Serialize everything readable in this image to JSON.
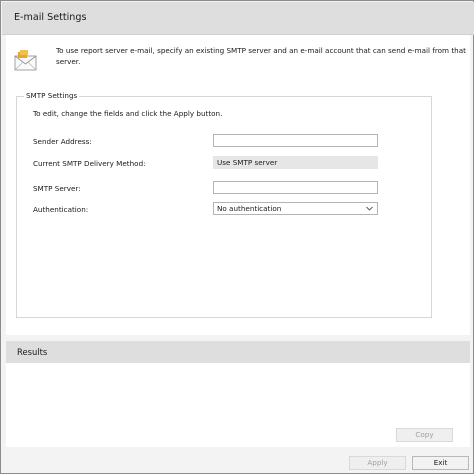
{
  "header": {
    "title": "E-mail Settings"
  },
  "intro": {
    "icon": "email-icon",
    "text": "To use report server e-mail, specify an existing SMTP server and an e-mail account that can send e-mail from that server."
  },
  "smtp_settings": {
    "legend": "SMTP Settings",
    "instruction": "To edit, change the fields and click the Apply button.",
    "sender_address": {
      "label": "Sender Address:",
      "value": ""
    },
    "delivery_method": {
      "label": "Current SMTP Delivery Method:",
      "value": "Use SMTP server"
    },
    "smtp_server": {
      "label": "SMTP Server:",
      "value": ""
    },
    "authentication": {
      "label": "Authentication:",
      "selected": "No authentication"
    }
  },
  "results": {
    "title": "Results"
  },
  "buttons": {
    "copy": "Copy",
    "apply": "Apply",
    "exit": "Exit"
  },
  "colors": {
    "header_bg": "#dedede",
    "panel_bg": "#ffffff",
    "frame_bg": "#f3f3f3",
    "disabled_text": "#a0a0a0"
  }
}
